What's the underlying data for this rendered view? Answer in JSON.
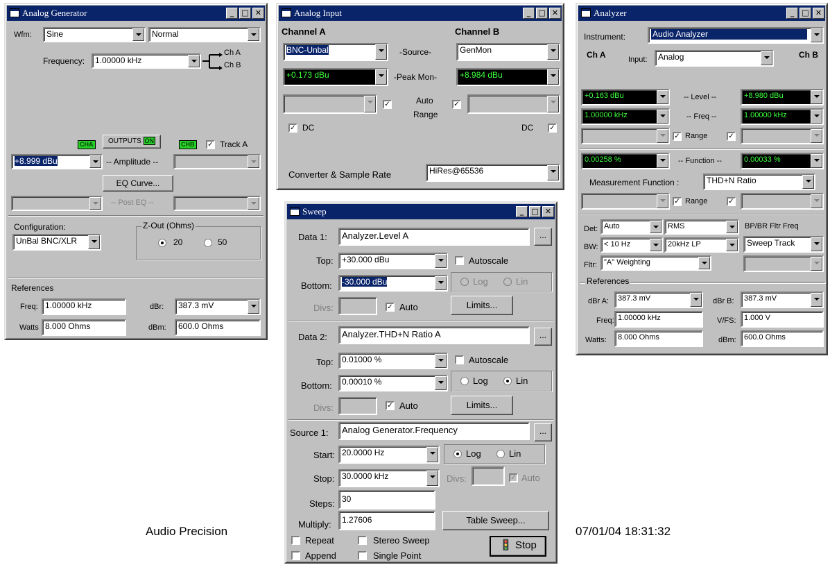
{
  "gen": {
    "title": "Analog Generator",
    "wfm_label": "Wfm:",
    "wfm": "Sine",
    "wfm_mode": "Normal",
    "freq_label": "Frequency:",
    "freq": "1.00000 kHz",
    "ch_a": "Ch A",
    "ch_b": "Ch B",
    "cha_badge": "CHA",
    "outputs": "OUTPUTS",
    "on": "ON",
    "chb_badge": "CHB",
    "track_a": "Track A",
    "amp_val": "+8.999  dBu",
    "amp_label": "-- Amplitude --",
    "eq_curve": "EQ Curve...",
    "post_eq": "-- Post EQ --",
    "config_label": "Configuration:",
    "config": "UnBal BNC/XLR",
    "zout_label": "Z-Out (Ohms)",
    "z20": "20",
    "z50": "50",
    "refs": "References",
    "freq_ref_label": "Freq:",
    "freq_ref": "1.00000 kHz",
    "dbr_label": "dBr:",
    "dbr": "387.3  mV",
    "watts_label": "Watts",
    "watts": "8.000   Ohms",
    "dbm_label": "dBm:",
    "dbm": "600.0   Ohms"
  },
  "ain": {
    "title": "Analog Input",
    "ch_a": "Channel A",
    "ch_b": "Channel B",
    "src_a": "BNC-Unbal",
    "src_label": "-Source-",
    "src_b": "GenMon",
    "peak_a": "+0.173  dBu",
    "peak_label": "-Peak Mon-",
    "peak_b": "+8.984  dBu",
    "auto": "Auto",
    "range": "Range",
    "dc": "DC",
    "conv_label": "Converter & Sample Rate",
    "conv": "HiRes@65536"
  },
  "sweep": {
    "title": "Sweep",
    "d1_label": "Data 1:",
    "d1": "Analyzer.Level A",
    "more": "...",
    "top_label": "Top:",
    "d1_top": "+30.000  dBu",
    "autoscale": "Autoscale",
    "bottom_label": "Bottom:",
    "d1_bottom": "-30.000  dBu",
    "log": "Log",
    "lin": "Lin",
    "divs": "Divs:",
    "auto": "Auto",
    "limits": "Limits...",
    "d2_label": "Data 2:",
    "d2": "Analyzer.THD+N Ratio A",
    "d2_top": "0.01000  %",
    "d2_bottom": "0.00010  %",
    "s1_label": "Source 1:",
    "s1": "Analog Generator.Frequency",
    "start_label": "Start:",
    "start": "20.0000  Hz",
    "stop_label": "Stop:",
    "stop": "30.0000 kHz",
    "steps_label": "Steps:",
    "steps": "30",
    "mult_label": "Multiply:",
    "mult": "1.27606",
    "table_sweep": "Table Sweep...",
    "repeat": "Repeat",
    "stereo": "Stereo Sweep",
    "append": "Append",
    "single": "Single Point",
    "stop_btn": "Stop"
  },
  "an": {
    "title": "Analyzer",
    "instr_label": "Instrument:",
    "instr": "Audio Analyzer",
    "ch_a": "Ch A",
    "input_label": "Input:",
    "input": "Analog",
    "ch_b": "Ch B",
    "lvl_a": "+0.163  dBu",
    "lvl_label": "-- Level --",
    "lvl_b": "+8.980  dBu",
    "frq_a": "1.00000 kHz",
    "frq_label": "-- Freq --",
    "frq_b": "1.00000 kHz",
    "range": "Range",
    "fn_a": "0.00258  %",
    "fn_label": "-- Function --",
    "fn_b": "0.00033  %",
    "mf_label": "Measurement Function :",
    "mf": "THD+N Ratio",
    "det_label": "Det:",
    "det": "Auto",
    "rms": "RMS",
    "bpbr": "BP/BR Fltr Freq",
    "bw_label": "BW:",
    "bw": "< 10 Hz",
    "bw2": "20kHz LP",
    "sweep_track": "Sweep Track",
    "fltr_label": "Fltr:",
    "fltr": "\"A\" Weighting",
    "refs": "References",
    "dbra_label": "dBr A:",
    "dbra": "387.3  mV",
    "dbrb_label": "dBr B:",
    "dbrb": "387.3  mV",
    "freq_label": "Freq:",
    "freq": "1.00000 kHz",
    "vfs_label": "V/FS:",
    "vfs": "1.000   V",
    "watts_label": "Watts:",
    "watts": "8.000   Ohms",
    "dbm_label": "dBm:",
    "dbm": "600.0   Ohms"
  },
  "footer": {
    "left": "Audio Precision",
    "right": "07/01/04 18:31:32"
  }
}
